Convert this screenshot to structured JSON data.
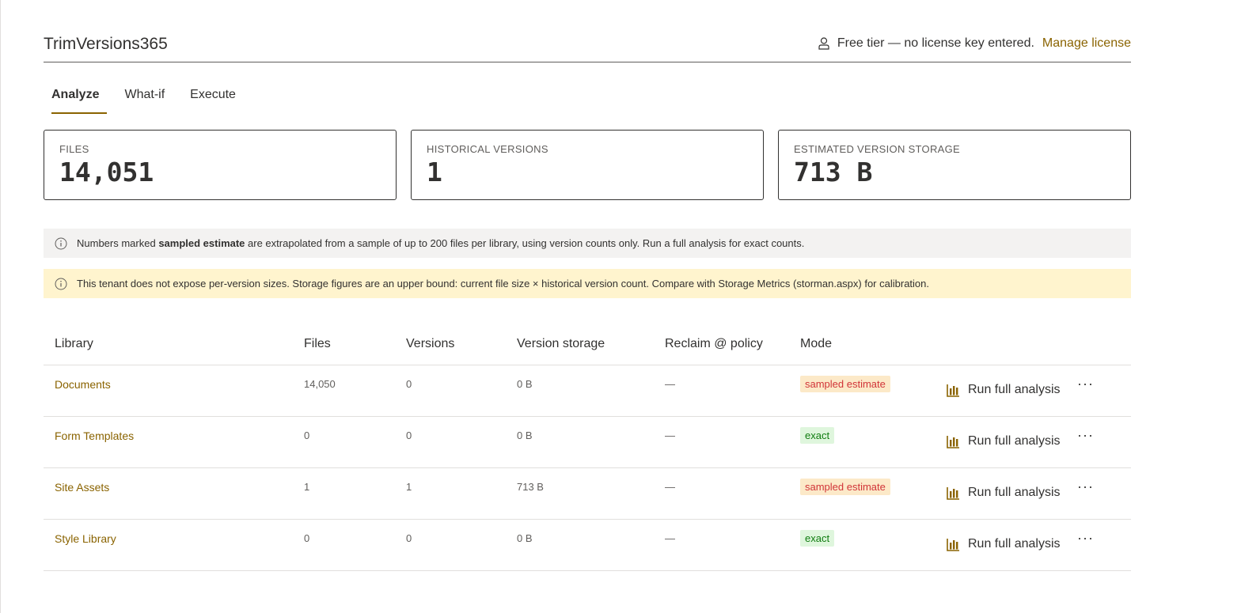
{
  "app": {
    "title": "TrimVersions365"
  },
  "license": {
    "status_text": "Free tier — no license key entered.",
    "link_label": "Manage license"
  },
  "tabs": [
    {
      "label": "Analyze",
      "active": true
    },
    {
      "label": "What-if",
      "active": false
    },
    {
      "label": "Execute",
      "active": false
    }
  ],
  "stats": [
    {
      "label": "FILES",
      "value": "14,051"
    },
    {
      "label": "HISTORICAL VERSIONS",
      "value": "1"
    },
    {
      "label": "ESTIMATED VERSION STORAGE",
      "value": "713 B"
    }
  ],
  "notices": {
    "info": {
      "prefix": "Numbers marked ",
      "bold": "sampled estimate",
      "suffix": " are extrapolated from a sample of up to 200 files per library, using version counts only. Run a full analysis for exact counts."
    },
    "warning": {
      "text": "This tenant does not expose per-version sizes. Storage figures are an upper bound: current file size × historical version count. Compare with Storage Metrics (storman.aspx) for calibration."
    }
  },
  "table": {
    "columns": [
      "Library",
      "Files",
      "Versions",
      "Version storage",
      "Reclaim @ policy",
      "Mode"
    ],
    "rows": [
      {
        "library": "Documents",
        "files": "14,050",
        "versions": "0",
        "storage": "0 B",
        "reclaim": "—",
        "mode": "sampled estimate",
        "mode_kind": "sampled",
        "action": "Run full analysis"
      },
      {
        "library": "Form Templates",
        "files": "0",
        "versions": "0",
        "storage": "0 B",
        "reclaim": "—",
        "mode": "exact",
        "mode_kind": "exact",
        "action": "Run full analysis"
      },
      {
        "library": "Site Assets",
        "files": "1",
        "versions": "1",
        "storage": "713 B",
        "reclaim": "—",
        "mode": "sampled estimate",
        "mode_kind": "sampled",
        "action": "Run full analysis"
      },
      {
        "library": "Style Library",
        "files": "0",
        "versions": "0",
        "storage": "0 B",
        "reclaim": "—",
        "mode": "exact",
        "mode_kind": "exact",
        "action": "Run full analysis"
      }
    ],
    "more_label": "···"
  },
  "icons": {
    "license": "person-icon",
    "notice": "info-icon",
    "run": "bar-chart-icon",
    "more": "more-icon"
  },
  "colors": {
    "accent": "#8a6300",
    "sampled_bg": "#fce9c8",
    "sampled_fg": "#d13438",
    "exact_bg": "#dff6dd",
    "exact_fg": "#107c10",
    "warn_bg": "#fff4ce",
    "info_bg": "#f3f2f1"
  }
}
